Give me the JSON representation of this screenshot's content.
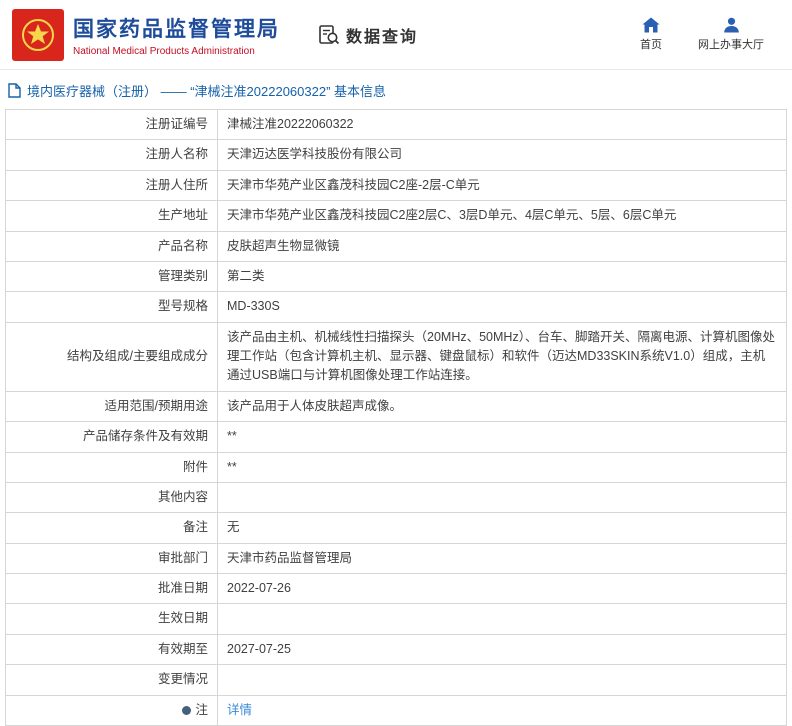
{
  "header": {
    "title_cn": "国家药品监督管理局",
    "title_en": "National Medical Products Administration",
    "section_label": "数据查询",
    "nav": [
      {
        "label": "首页",
        "icon": "home-icon"
      },
      {
        "label": "网上办事大厅",
        "icon": "person-icon"
      }
    ]
  },
  "breadcrumb": {
    "icon": "document-icon",
    "text": "境内医疗器械（注册） —— “津械注准20222060322” 基本信息"
  },
  "colors": {
    "brand_blue": "#1e4c9a",
    "brand_red": "#d8261c",
    "breadcrumb_blue": "#1661ab",
    "link_blue": "#3a8bd8",
    "table_border": "#d6d6d6"
  },
  "table": {
    "rows": [
      {
        "label": "注册证编号",
        "value": "津械注准20222060322"
      },
      {
        "label": "注册人名称",
        "value": "天津迈达医学科技股份有限公司"
      },
      {
        "label": "注册人住所",
        "value": "天津市华苑产业区鑫茂科技园C2座-2层-C单元"
      },
      {
        "label": "生产地址",
        "value": "天津市华苑产业区鑫茂科技园C2座2层C、3层D单元、4层C单元、5层、6层C单元"
      },
      {
        "label": "产品名称",
        "value": "皮肤超声生物显微镜"
      },
      {
        "label": "管理类别",
        "value": "第二类"
      },
      {
        "label": "型号规格",
        "value": "MD-330S"
      },
      {
        "label": "结构及组成/主要组成成分",
        "value": "该产品由主机、机械线性扫描探头（20MHz、50MHz）、台车、脚踏开关、隔离电源、计算机图像处理工作站（包含计算机主机、显示器、键盘鼠标）和软件（迈达MD33SKIN系统V1.0）组成，主机通过USB端口与计算机图像处理工作站连接。"
      },
      {
        "label": "适用范围/预期用途",
        "value": "该产品用于人体皮肤超声成像。"
      },
      {
        "label": "产品储存条件及有效期",
        "value": "**"
      },
      {
        "label": "附件",
        "value": "**"
      },
      {
        "label": "其他内容",
        "value": ""
      },
      {
        "label": "备注",
        "value": "无"
      },
      {
        "label": "审批部门",
        "value": "天津市药品监督管理局"
      },
      {
        "label": "批准日期",
        "value": "2022-07-26"
      },
      {
        "label": "生效日期",
        "value": ""
      },
      {
        "label": "有效期至",
        "value": "2027-07-25"
      },
      {
        "label": "变更情况",
        "value": ""
      },
      {
        "label": "注",
        "label_icon": "note-icon",
        "value": "详情",
        "link": true
      }
    ]
  }
}
